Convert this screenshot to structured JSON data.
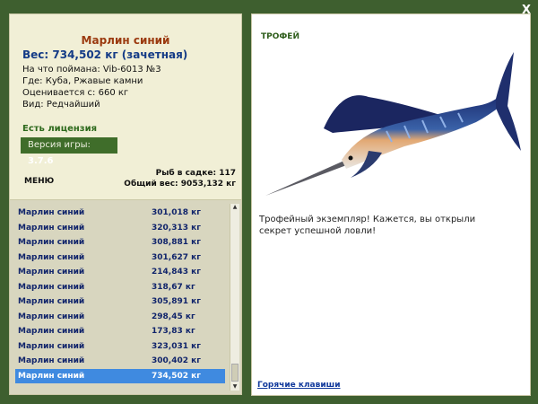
{
  "window": {
    "close_label": "X"
  },
  "info": {
    "title": "Марлин синий",
    "weight": "Вес: 734,502 кг (зачетная)",
    "caught_on": "На что поймана: Vib-6013 №3",
    "location": "Где: Куба, Ржавые камни",
    "valued_from": "Оценивается с: 660 кг",
    "rarity": "Вид: Редчайший",
    "license": "Есть лицензия",
    "version_label": "Версия игры:",
    "version_value": "3.7.6"
  },
  "menu": {
    "label": "МЕНЮ",
    "keep_count": "Рыб в садке: 117",
    "total_weight": "Общий вес: 9053,132 кг"
  },
  "catch_list": [
    {
      "name": "Марлин синий",
      "weight": "301,018 кг"
    },
    {
      "name": "Марлин синий",
      "weight": "320,313 кг"
    },
    {
      "name": "Марлин синий",
      "weight": "308,881 кг"
    },
    {
      "name": "Марлин синий",
      "weight": "301,627 кг"
    },
    {
      "name": "Марлин синий",
      "weight": "214,843 кг"
    },
    {
      "name": "Марлин синий",
      "weight": "318,67 кг"
    },
    {
      "name": "Марлин синий",
      "weight": "305,891 кг"
    },
    {
      "name": "Марлин синий",
      "weight": "298,45 кг"
    },
    {
      "name": "Марлин синий",
      "weight": "173,83 кг"
    },
    {
      "name": "Марлин синий",
      "weight": "323,031 кг"
    },
    {
      "name": "Марлин синий",
      "weight": "300,402 кг"
    },
    {
      "name": "Марлин синий",
      "weight": "734,502 кг",
      "selected": true
    }
  ],
  "trophy": {
    "label": "ТРОФЕЙ",
    "description": "Трофейный экземпляр! Кажется, вы открыли секрет успешной ловли!",
    "hotkeys_link": "Горячие клавиши"
  }
}
